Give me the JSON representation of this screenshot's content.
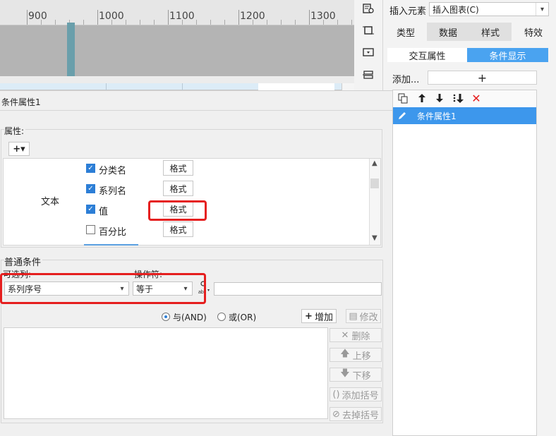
{
  "ruler": {
    "labels": [
      "900",
      "1000",
      "1100",
      "1200",
      "1300"
    ]
  },
  "right_panel": {
    "insert_element_label": "插入元素",
    "insert_element_value": "插入图表(C)",
    "tabs": [
      "类型",
      "数据",
      "样式",
      "特效"
    ],
    "subtabs": [
      "交互属性",
      "条件显示"
    ],
    "add_label": "添加...",
    "add_button": "+",
    "condition_items": [
      "条件属性1"
    ]
  },
  "dialog": {
    "title": "条件属性1",
    "attributes_label": "属性:",
    "add_attr_button": "+▾",
    "text_group_label": "文本",
    "options": [
      {
        "label": "分类名",
        "checked": true,
        "format_label": "格式"
      },
      {
        "label": "系列名",
        "checked": true,
        "format_label": "格式"
      },
      {
        "label": "值",
        "checked": true,
        "format_label": "格式"
      },
      {
        "label": "百分比",
        "checked": false,
        "format_label": "格式"
      }
    ],
    "common_conditions_label": "普通条件",
    "column_label": "可选列:",
    "operator_label": "操作符:",
    "column_value": "系列序号",
    "operator_value": "等于",
    "value_input": "",
    "and_label": "与(AND)",
    "or_label": "或(OR)",
    "add_button": "增加",
    "modify_button": "修改",
    "delete_button": "删除",
    "up_button": "上移",
    "down_button": "下移",
    "add_bracket_button": "添加括号",
    "remove_bracket_button": "去掉括号"
  },
  "colors": {
    "accent": "#3d97ec",
    "highlight": "#e51f1f",
    "canvas": "#b4b4b4"
  }
}
